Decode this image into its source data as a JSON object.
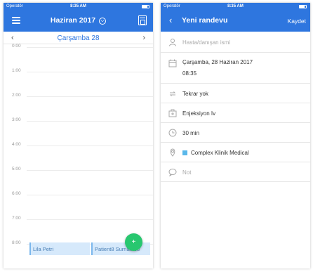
{
  "left_screen": {
    "status_bar": {
      "carrier": "Operatör",
      "time": "8:35 AM"
    },
    "nav": {
      "month_title": "Haziran 2017",
      "title_chevron": "⌵"
    },
    "day_bar": {
      "prev": "‹",
      "next": "›",
      "title": "Çarşamba 28"
    },
    "hours": [
      "0:00",
      "1:00",
      "2:00",
      "3:00",
      "4:00",
      "5:00",
      "6:00",
      "7:00",
      "8:00"
    ],
    "events": [
      {
        "title": "Lila Petri"
      },
      {
        "title": "Patient8 Surname8"
      }
    ],
    "fab_label": "+"
  },
  "right_screen": {
    "status_bar": {
      "carrier": "Operatör",
      "time": "8:35 AM"
    },
    "nav": {
      "back": "‹",
      "title": "Yeni randevu",
      "save": "Kaydet"
    },
    "form": {
      "patient_placeholder": "Hasta/danışan ismi",
      "date": "Çarşamba, 28 Haziran 2017",
      "time": "08:35",
      "repeat": "Tekrar yok",
      "service": "Enjeksiyon Iv",
      "duration": "30 min",
      "location": "Complex Klinik Medical",
      "location_color": "#5ab8ea",
      "note_placeholder": "Not"
    }
  },
  "colors": {
    "primary": "#2e76df",
    "fab": "#28c76f",
    "event_bg": "#d6e9fb"
  }
}
